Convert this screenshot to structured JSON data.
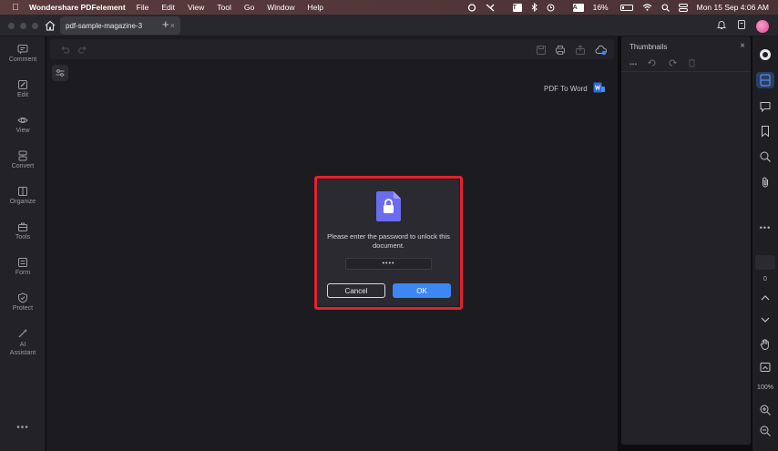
{
  "menubar": {
    "app_name": "Wondershare PDFelement",
    "menus": [
      "File",
      "Edit",
      "View",
      "Tool",
      "Go",
      "Window",
      "Help"
    ],
    "battery": "16%",
    "datetime": "Mon 15 Sep  4:06 AM"
  },
  "tabbar": {
    "tab_title": "pdf-sample-magazine-3",
    "close_glyph": "×",
    "new_tab_glyph": "+"
  },
  "sidebar": {
    "items": [
      {
        "label": "Comment",
        "icon": "comment-icon"
      },
      {
        "label": "Edit",
        "icon": "edit-icon"
      },
      {
        "label": "View",
        "icon": "eye-icon"
      },
      {
        "label": "Convert",
        "icon": "convert-icon"
      },
      {
        "label": "Organize",
        "icon": "organize-icon"
      },
      {
        "label": "Tools",
        "icon": "toolbox-icon"
      },
      {
        "label": "Form",
        "icon": "form-icon"
      },
      {
        "label": "Protect",
        "icon": "shield-icon"
      },
      {
        "label": "AI Assistant",
        "icon": "ai-sparkle-icon"
      }
    ],
    "more": "•••"
  },
  "main": {
    "pdf_to_word": "PDF To Word"
  },
  "dialog": {
    "message": "Please enter the password to unlock this document.",
    "password_mask": "••••",
    "cancel_label": "Cancel",
    "ok_label": "OK"
  },
  "thumbnails": {
    "title": "Thumbnails",
    "close_glyph": "×"
  },
  "rail": {
    "more": "•••",
    "page_number": "0",
    "zoom": "100%"
  },
  "colors": {
    "accent": "#3d87f5",
    "highlight": "#e5202e",
    "lock_doc": "#6c6cf0"
  }
}
